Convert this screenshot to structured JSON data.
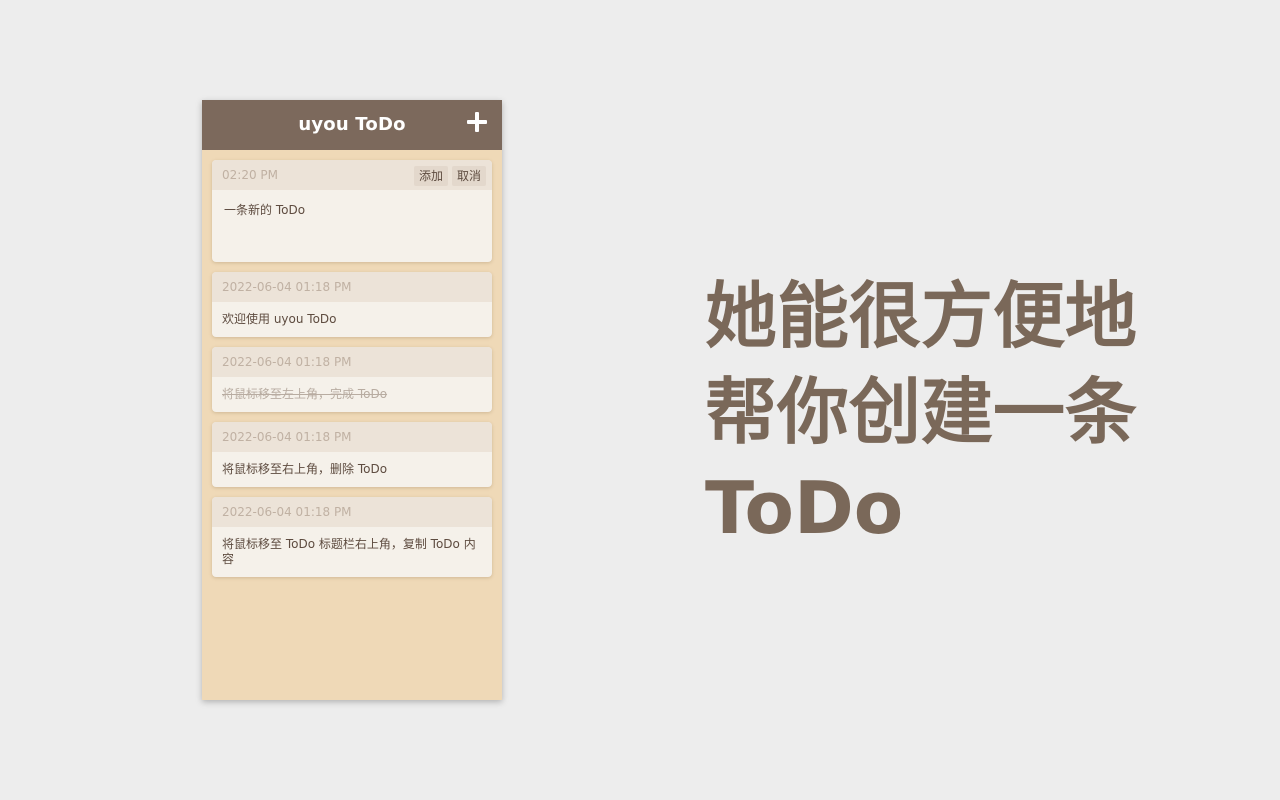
{
  "app": {
    "title": "uyou ToDo",
    "add_icon": "plus-icon"
  },
  "new_todo": {
    "time": "02:20 PM",
    "add_label": "添加",
    "cancel_label": "取消",
    "content": "一条新的 ToDo"
  },
  "todos": [
    {
      "time": "2022-06-04 01:18 PM",
      "content": "欢迎使用 uyou ToDo",
      "done": false
    },
    {
      "time": "2022-06-04 01:18 PM",
      "content": "将鼠标移至左上角，完成 ToDo",
      "done": true
    },
    {
      "time": "2022-06-04 01:18 PM",
      "content": "将鼠标移至右上角，删除 ToDo",
      "done": false
    },
    {
      "time": "2022-06-04 01:18 PM",
      "content": "将鼠标移至 ToDo 标题栏右上角，复制 ToDo 内容",
      "done": false
    }
  ],
  "slogan": {
    "line1": "她能很方便地",
    "line2": "帮你创建一条",
    "line3": "ToDo"
  },
  "colors": {
    "background": "#ededed",
    "header": "#7c695c",
    "panel": "#efd9b7",
    "card": "#f5f1ea",
    "card_head": "#ece3d8",
    "slogan": "#7a6859"
  }
}
